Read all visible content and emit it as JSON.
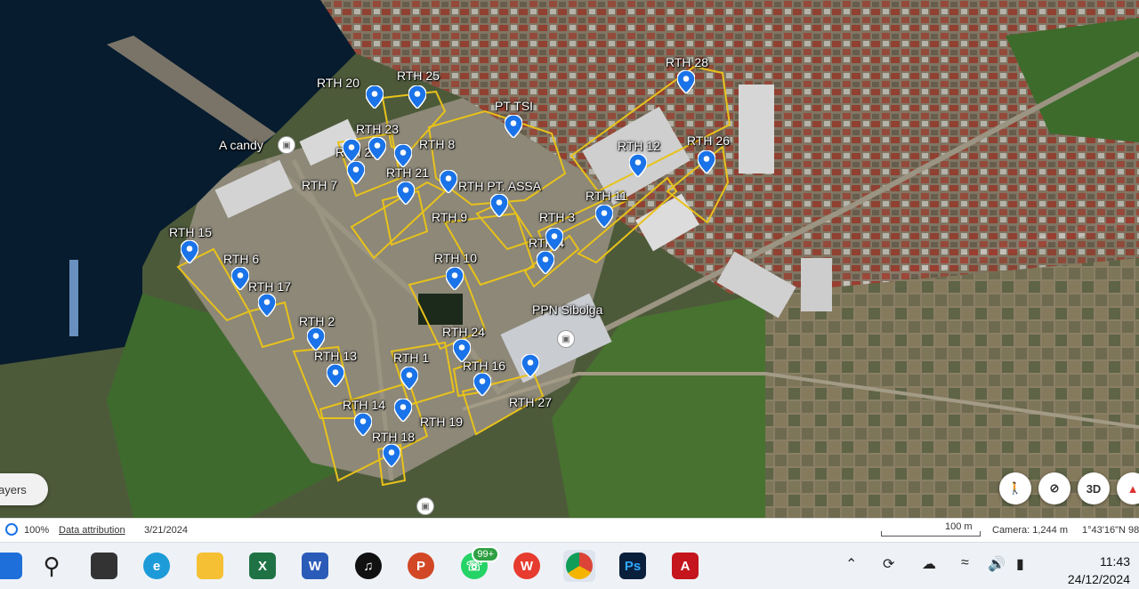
{
  "map": {
    "labels": [
      {
        "text": "RTH 20"
      },
      {
        "text": "RTH 25"
      },
      {
        "text": "RTH 28"
      },
      {
        "text": "PT TSI"
      },
      {
        "text": "RTH 23"
      },
      {
        "text": "A candy"
      },
      {
        "text": "RTH 8"
      },
      {
        "text": "RTH 12"
      },
      {
        "text": "RTH 26"
      },
      {
        "text": "RTH 22"
      },
      {
        "text": "RTH 21"
      },
      {
        "text": "RTH 7"
      },
      {
        "text": "RTH PT. ASSA"
      },
      {
        "text": "RTH 11"
      },
      {
        "text": "RTH 9"
      },
      {
        "text": "RTH 3"
      },
      {
        "text": "RTH 15"
      },
      {
        "text": "RTH 4"
      },
      {
        "text": "RTH 6"
      },
      {
        "text": "RTH 10"
      },
      {
        "text": "RTH 17"
      },
      {
        "text": "PPN Sibolga"
      },
      {
        "text": "RTH 2"
      },
      {
        "text": "RTH 24"
      },
      {
        "text": "RTH 13"
      },
      {
        "text": "RTH 1"
      },
      {
        "text": "RTH 16"
      },
      {
        "text": "RTH 27"
      },
      {
        "text": "RTH 14"
      },
      {
        "text": "RTH 19"
      },
      {
        "text": "RTH 18"
      }
    ],
    "layers_label": "ayers",
    "controls": {
      "view3d": "3D"
    }
  },
  "status": {
    "zoom": "100%",
    "attribution": "Data attribution",
    "date": "3/21/2024",
    "scale": "100 m",
    "camera": "Camera: 1,244 m",
    "coords": "1°43'16\"N 98"
  },
  "taskbar": {
    "whatsapp_badge": "99+",
    "time": "11:43",
    "date": "24/12/2024"
  },
  "colors": {
    "outline": "#e8c21a",
    "pin": "#1a73e8"
  }
}
